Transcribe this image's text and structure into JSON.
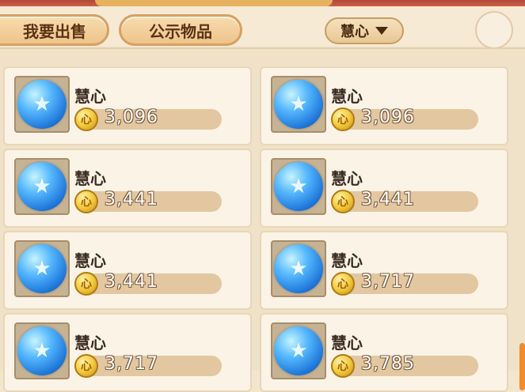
{
  "tabs": {
    "sell_label": "我要出售",
    "public_label": "公示物品"
  },
  "filter": {
    "selected": "慧心"
  },
  "listings": [
    {
      "name": "慧心",
      "price": "3,096"
    },
    {
      "name": "慧心",
      "price": "3,096"
    },
    {
      "name": "慧心",
      "price": "3,441"
    },
    {
      "name": "慧心",
      "price": "3,441"
    },
    {
      "name": "慧心",
      "price": "3,441"
    },
    {
      "name": "慧心",
      "price": "3,717"
    },
    {
      "name": "慧心",
      "price": "3,717"
    },
    {
      "name": "慧心",
      "price": "3,785"
    }
  ],
  "colors": {
    "background": "#f3e6cf",
    "card": "#fbf3e6",
    "accent": "#d6a064"
  },
  "icons": {
    "item": "blue-gem-icon",
    "currency": "gold-coin-icon",
    "filter_caret": "caret-down-icon"
  }
}
